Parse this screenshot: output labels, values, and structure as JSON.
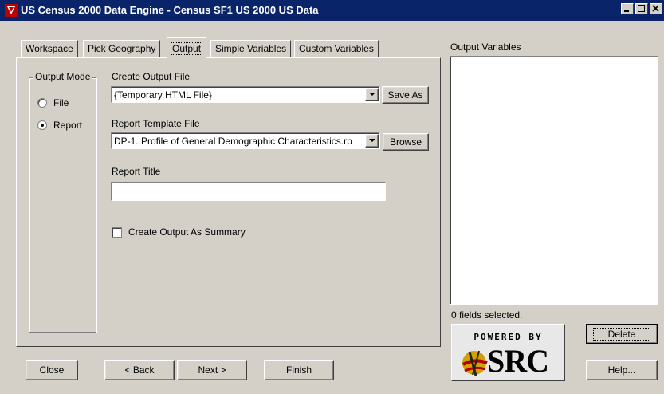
{
  "window": {
    "title": "US Census 2000 Data Engine - Census SF1 US 2000 US Data"
  },
  "tabs": [
    {
      "label": "Workspace"
    },
    {
      "label": "Pick Geography"
    },
    {
      "label": "Output"
    },
    {
      "label": "Simple Variables"
    },
    {
      "label": "Custom Variables"
    }
  ],
  "output_mode": {
    "label": "Output Mode",
    "options": [
      {
        "label": "File",
        "selected": false
      },
      {
        "label": "Report",
        "selected": true
      }
    ]
  },
  "create_output_file": {
    "label": "Create Output File",
    "value": "{Temporary HTML File}",
    "save_as_label": "Save As"
  },
  "report_template": {
    "label": "Report Template File",
    "value": "DP-1. Profile of General Demographic Characteristics.rp",
    "browse_label": "Browse"
  },
  "report_title": {
    "label": "Report Title",
    "value": ""
  },
  "summary_checkbox": {
    "label": "Create Output As Summary",
    "checked": false
  },
  "output_variables": {
    "label": "Output Variables",
    "status": "0 fields selected."
  },
  "logo": {
    "powered_by": "POWERED BY",
    "brand": "SRC"
  },
  "buttons": {
    "close": "Close",
    "back": "< Back",
    "next": "Next >",
    "finish": "Finish",
    "delete": "Delete",
    "help": "Help..."
  }
}
